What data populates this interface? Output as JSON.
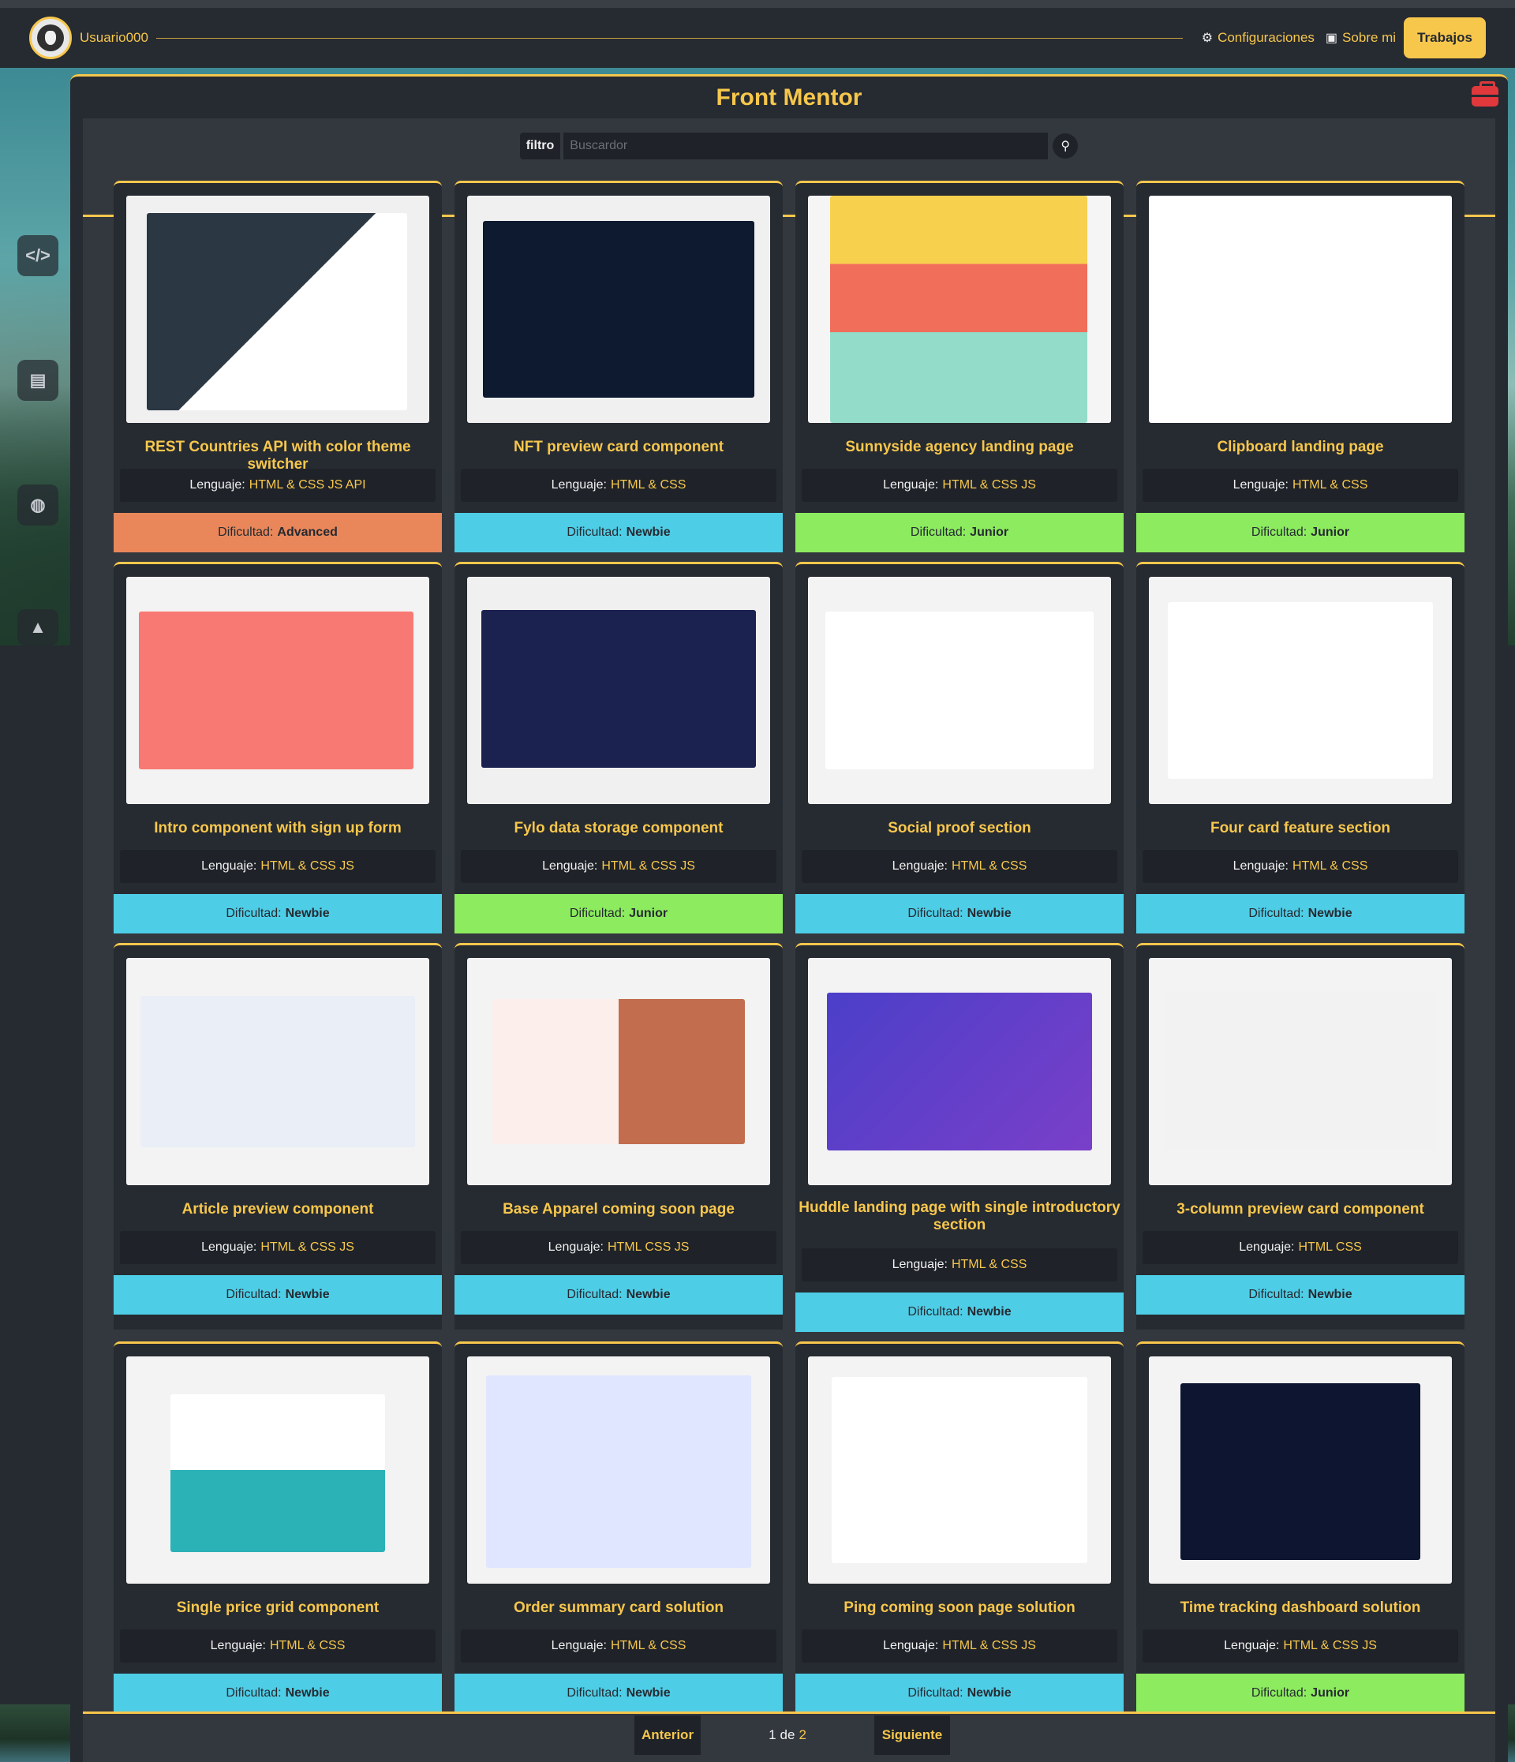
{
  "header": {
    "username": "Usuario000",
    "links": [
      {
        "label": "Configuraciones",
        "icon": "gear-icon"
      },
      {
        "label": "Sobre mi",
        "icon": "id-card-icon"
      }
    ],
    "active_button": "Trabajos"
  },
  "sidebar_icons": [
    "code-icon",
    "id-card-icon",
    "gamepad-icon",
    "hat-icon"
  ],
  "panel": {
    "title": "Front Mentor",
    "title_icon": "briefcase-icon"
  },
  "filter": {
    "label": "filtro",
    "placeholder": "Buscardor",
    "value": ""
  },
  "card_labels": {
    "language": "Lenguaje:",
    "difficulty": "Dificultad:"
  },
  "difficulty_colors": {
    "Advanced": "#e9875a",
    "Newbie": "#4ecde6",
    "Junior": "#8ceb5e"
  },
  "projects": [
    {
      "title": "REST Countries API with color theme switcher",
      "language": "HTML & CSS JS API",
      "difficulty": "Advanced"
    },
    {
      "title": "NFT preview card component",
      "language": "HTML & CSS",
      "difficulty": "Newbie"
    },
    {
      "title": "Sunnyside agency landing page",
      "language": "HTML & CSS JS",
      "difficulty": "Junior"
    },
    {
      "title": "Clipboard landing page",
      "language": "HTML & CSS",
      "difficulty": "Junior"
    },
    {
      "title": "Intro component with sign up form",
      "language": "HTML & CSS JS",
      "difficulty": "Newbie"
    },
    {
      "title": "Fylo data storage component",
      "language": "HTML & CSS JS",
      "difficulty": "Junior"
    },
    {
      "title": "Social proof section",
      "language": "HTML & CSS",
      "difficulty": "Newbie"
    },
    {
      "title": "Four card feature section",
      "language": "HTML & CSS",
      "difficulty": "Newbie"
    },
    {
      "title": "Article preview component",
      "language": "HTML & CSS JS",
      "difficulty": "Newbie"
    },
    {
      "title": "Base Apparel coming soon page",
      "language": "HTML CSS JS",
      "difficulty": "Newbie"
    },
    {
      "title": "Huddle landing page with single introductory section",
      "language": "HTML & CSS",
      "difficulty": "Newbie"
    },
    {
      "title": "3-column preview card component",
      "language": "HTML CSS",
      "difficulty": "Newbie"
    },
    {
      "title": "Single price grid component",
      "language": "HTML & CSS",
      "difficulty": "Newbie"
    },
    {
      "title": "Order summary card solution",
      "language": "HTML & CSS",
      "difficulty": "Newbie"
    },
    {
      "title": "Ping coming soon page solution",
      "language": "HTML & CSS JS",
      "difficulty": "Newbie"
    },
    {
      "title": "Time tracking dashboard solution",
      "language": "HTML & CSS JS",
      "difficulty": "Junior"
    }
  ],
  "pagination": {
    "prev": "Anterior",
    "current": "1",
    "separator": "de",
    "total": "2",
    "next": "Siguiente"
  }
}
